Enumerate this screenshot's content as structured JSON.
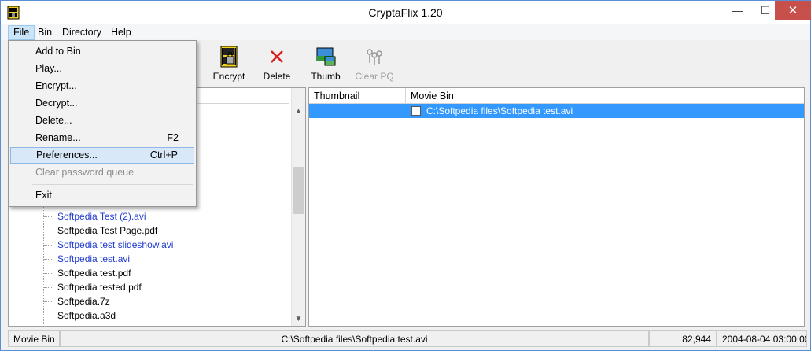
{
  "window": {
    "title": "CryptaFlix 1.20",
    "min_glyph": "—",
    "max_glyph": "☐",
    "close_glyph": "✕"
  },
  "menubar": {
    "file": "File",
    "bin": "Bin",
    "directory": "Directory",
    "help": "Help"
  },
  "toolbar": {
    "encrypt": "Encrypt",
    "delete": "Delete",
    "thumb": "Thumb",
    "clear_pq": "Clear PQ"
  },
  "file_menu": {
    "items": [
      {
        "label": "Add to Bin",
        "shortcut": ""
      },
      {
        "label": "Play...",
        "shortcut": ""
      },
      {
        "label": "Encrypt...",
        "shortcut": ""
      },
      {
        "label": "Decrypt...",
        "shortcut": ""
      },
      {
        "label": "Delete...",
        "shortcut": ""
      },
      {
        "label": "Rename...",
        "shortcut": "F2"
      },
      {
        "label": "Preferences...",
        "shortcut": "Ctrl+P"
      },
      {
        "label": "Clear password queue",
        "shortcut": ""
      },
      {
        "label": "Exit",
        "shortcut": ""
      }
    ]
  },
  "tree": {
    "items": [
      {
        "label": "Softpedia Test (2).avi",
        "kind": "video"
      },
      {
        "label": "Softpedia Test Page.pdf",
        "kind": "file"
      },
      {
        "label": "Softpedia test slideshow.avi",
        "kind": "video"
      },
      {
        "label": "Softpedia test.avi",
        "kind": "video"
      },
      {
        "label": "Softpedia test.pdf",
        "kind": "file"
      },
      {
        "label": "Softpedia tested.pdf",
        "kind": "file"
      },
      {
        "label": "Softpedia.7z",
        "kind": "file"
      },
      {
        "label": "Softpedia.a3d",
        "kind": "file"
      }
    ]
  },
  "list": {
    "col_thumbnail": "Thumbnail",
    "col_movie_bin": "Movie Bin",
    "rows": [
      {
        "path": "C:\\Softpedia files\\Softpedia test.avi",
        "selected": true
      }
    ]
  },
  "status": {
    "mode": "Movie Bin",
    "path": "C:\\Softpedia files\\Softpedia test.avi",
    "size": "82,944",
    "date": "2004-08-04  03:00:00"
  },
  "colors": {
    "selection": "#3399ff",
    "link_blue": "#1f3bcf",
    "close_red": "#c7504b"
  }
}
